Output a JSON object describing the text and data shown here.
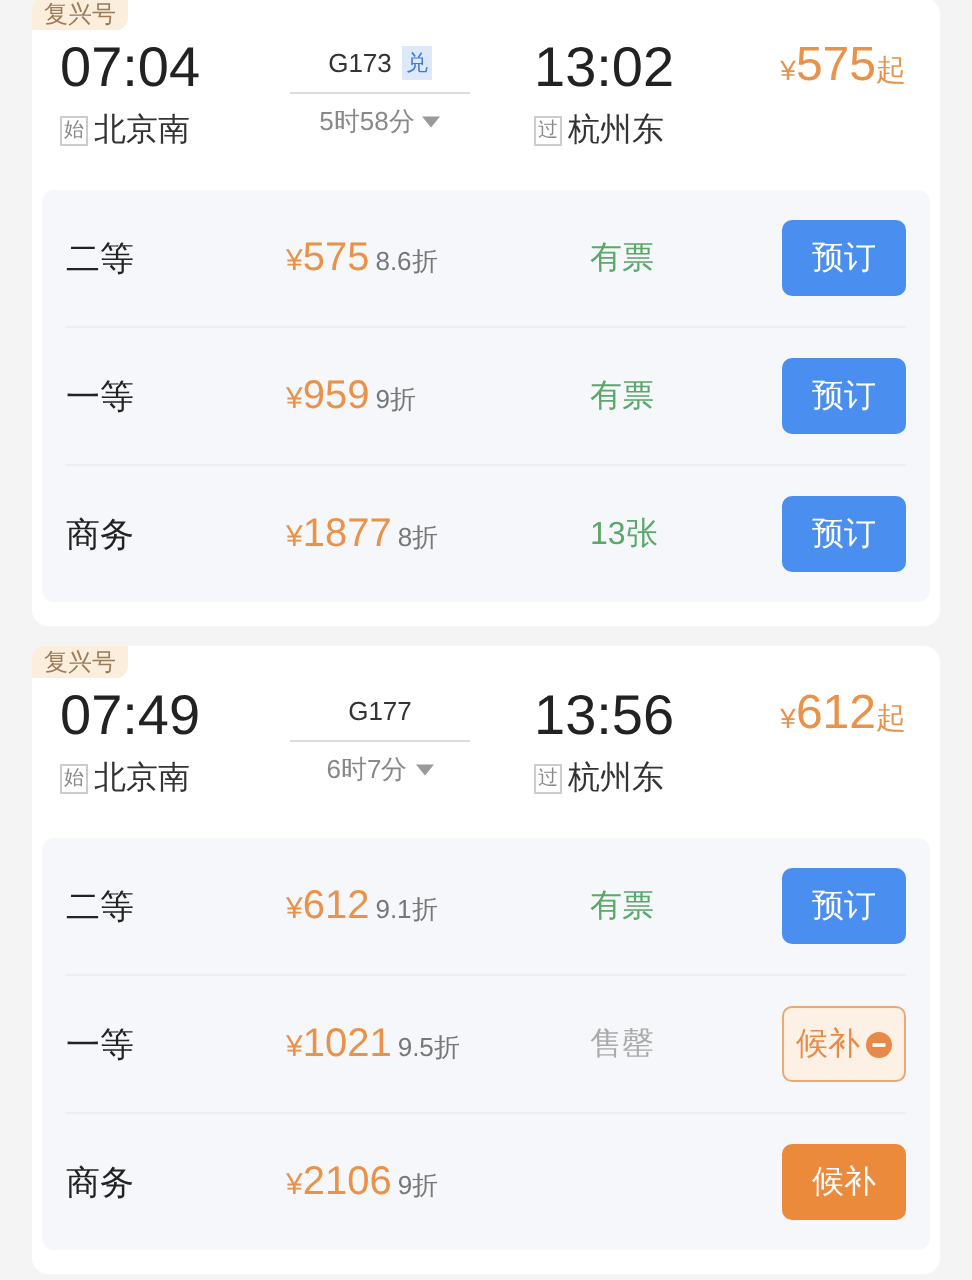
{
  "trains": [
    {
      "badge": "复兴号",
      "depart_time": "07:04",
      "depart_tag": "始",
      "depart_station": "北京南",
      "train_no": "G173",
      "train_tag": "兑",
      "duration": "5时58分",
      "arrive_time": "13:02",
      "arrive_tag": "过",
      "arrive_station": "杭州东",
      "price": "575",
      "price_currency": "¥",
      "price_suffix": "起",
      "seats": [
        {
          "name": "二等",
          "currency": "¥",
          "price": "575",
          "discount": "8.6折",
          "status": "有票",
          "available": true,
          "button": "预订",
          "kind": "book"
        },
        {
          "name": "一等",
          "currency": "¥",
          "price": "959",
          "discount": "9折",
          "status": "有票",
          "available": true,
          "button": "预订",
          "kind": "book"
        },
        {
          "name": "商务",
          "currency": "¥",
          "price": "1877",
          "discount": "8折",
          "status": "13张",
          "available": true,
          "button": "预订",
          "kind": "book"
        }
      ]
    },
    {
      "badge": "复兴号",
      "depart_time": "07:49",
      "depart_tag": "始",
      "depart_station": "北京南",
      "train_no": "G177",
      "duration": "6时7分",
      "arrive_time": "13:56",
      "arrive_tag": "过",
      "arrive_station": "杭州东",
      "price": "612",
      "price_currency": "¥",
      "price_suffix": "起",
      "seats": [
        {
          "name": "二等",
          "currency": "¥",
          "price": "612",
          "discount": "9.1折",
          "status": "有票",
          "available": true,
          "button": "预订",
          "kind": "book"
        },
        {
          "name": "一等",
          "currency": "¥",
          "price": "1021",
          "discount": "9.5折",
          "status": "售罄",
          "available": false,
          "button": "候补",
          "kind": "waitlist"
        },
        {
          "name": "商务",
          "currency": "¥",
          "price": "2106",
          "discount": "9折",
          "button": "候补",
          "kind": "waitlist-filled"
        }
      ]
    }
  ]
}
